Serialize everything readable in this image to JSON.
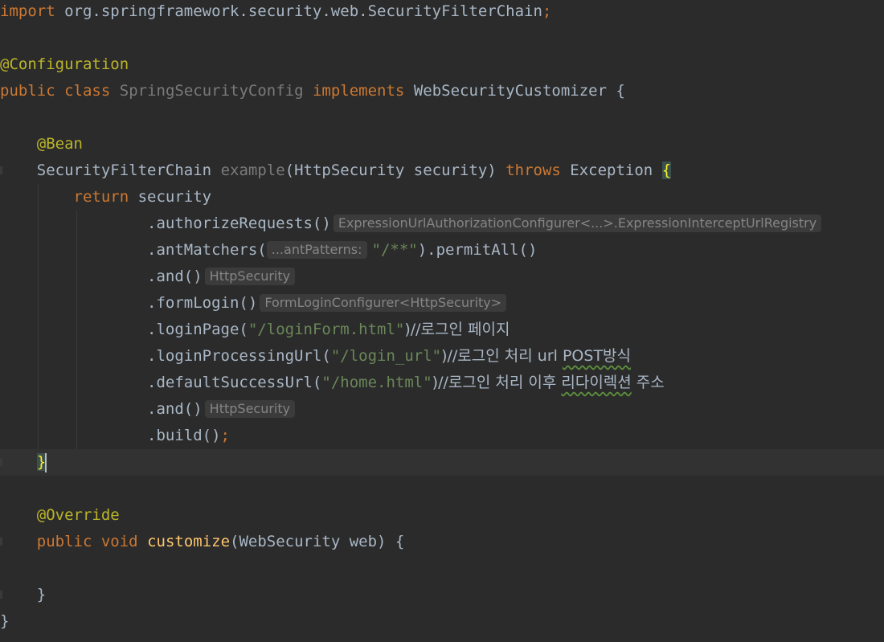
{
  "code": {
    "import_kw": "import",
    "import_path": " org.springframework.security.web.SecurityFilterChain",
    "semicolon": ";",
    "configuration_annotation": "@Configuration",
    "public_kw": "public",
    "class_kw": "class",
    "class_name": "SpringSecurityConfig",
    "implements_kw": "implements",
    "interface_name": "WebSecurityCustomizer",
    "open_brace": "{",
    "close_brace": "}",
    "bean_annotation": "@Bean",
    "return_type": "SecurityFilterChain",
    "method_name": "example",
    "method_params": "(HttpSecurity security)",
    "throws_kw": "throws",
    "exception_type": "Exception",
    "return_kw": "return",
    "security_var": "security",
    "authorize_requests": ".authorizeRequests()",
    "hint_authorize": "ExpressionUrlAuthorizationConfigurer<...>.ExpressionInterceptUrlRegistry",
    "ant_matchers_open": ".antMatchers(",
    "hint_ant_param": "...antPatterns:",
    "ant_pattern_string": "\"/**\"",
    "permit_all": ").permitAll()",
    "and_call": ".and()",
    "hint_http_security": "HttpSecurity",
    "form_login": ".formLogin()",
    "hint_form_login": "FormLoginConfigurer<HttpSecurity>",
    "login_page_open": ".loginPage(",
    "login_page_string": "\"/loginForm.html\"",
    "login_page_comment": ")//로그인 페이지",
    "login_processing_open": ".loginProcessingUrl(",
    "login_processing_string": "\"/login_url\"",
    "login_processing_comment": ")//로그인 처리 url ",
    "login_processing_comment_post": "POST방식",
    "default_success_open": ".defaultSuccessUrl(",
    "default_success_string": "\"/home.html\"",
    "default_success_comment": ")//로그인 처리 이후 ",
    "default_success_comment_redirect": "리다이렉션",
    "default_success_comment_tail": " 주소",
    "build_call": ".build()",
    "override_annotation": "@Override",
    "void_kw": "void",
    "customize_name": "customize",
    "customize_params": "(WebSecurity web) {"
  }
}
